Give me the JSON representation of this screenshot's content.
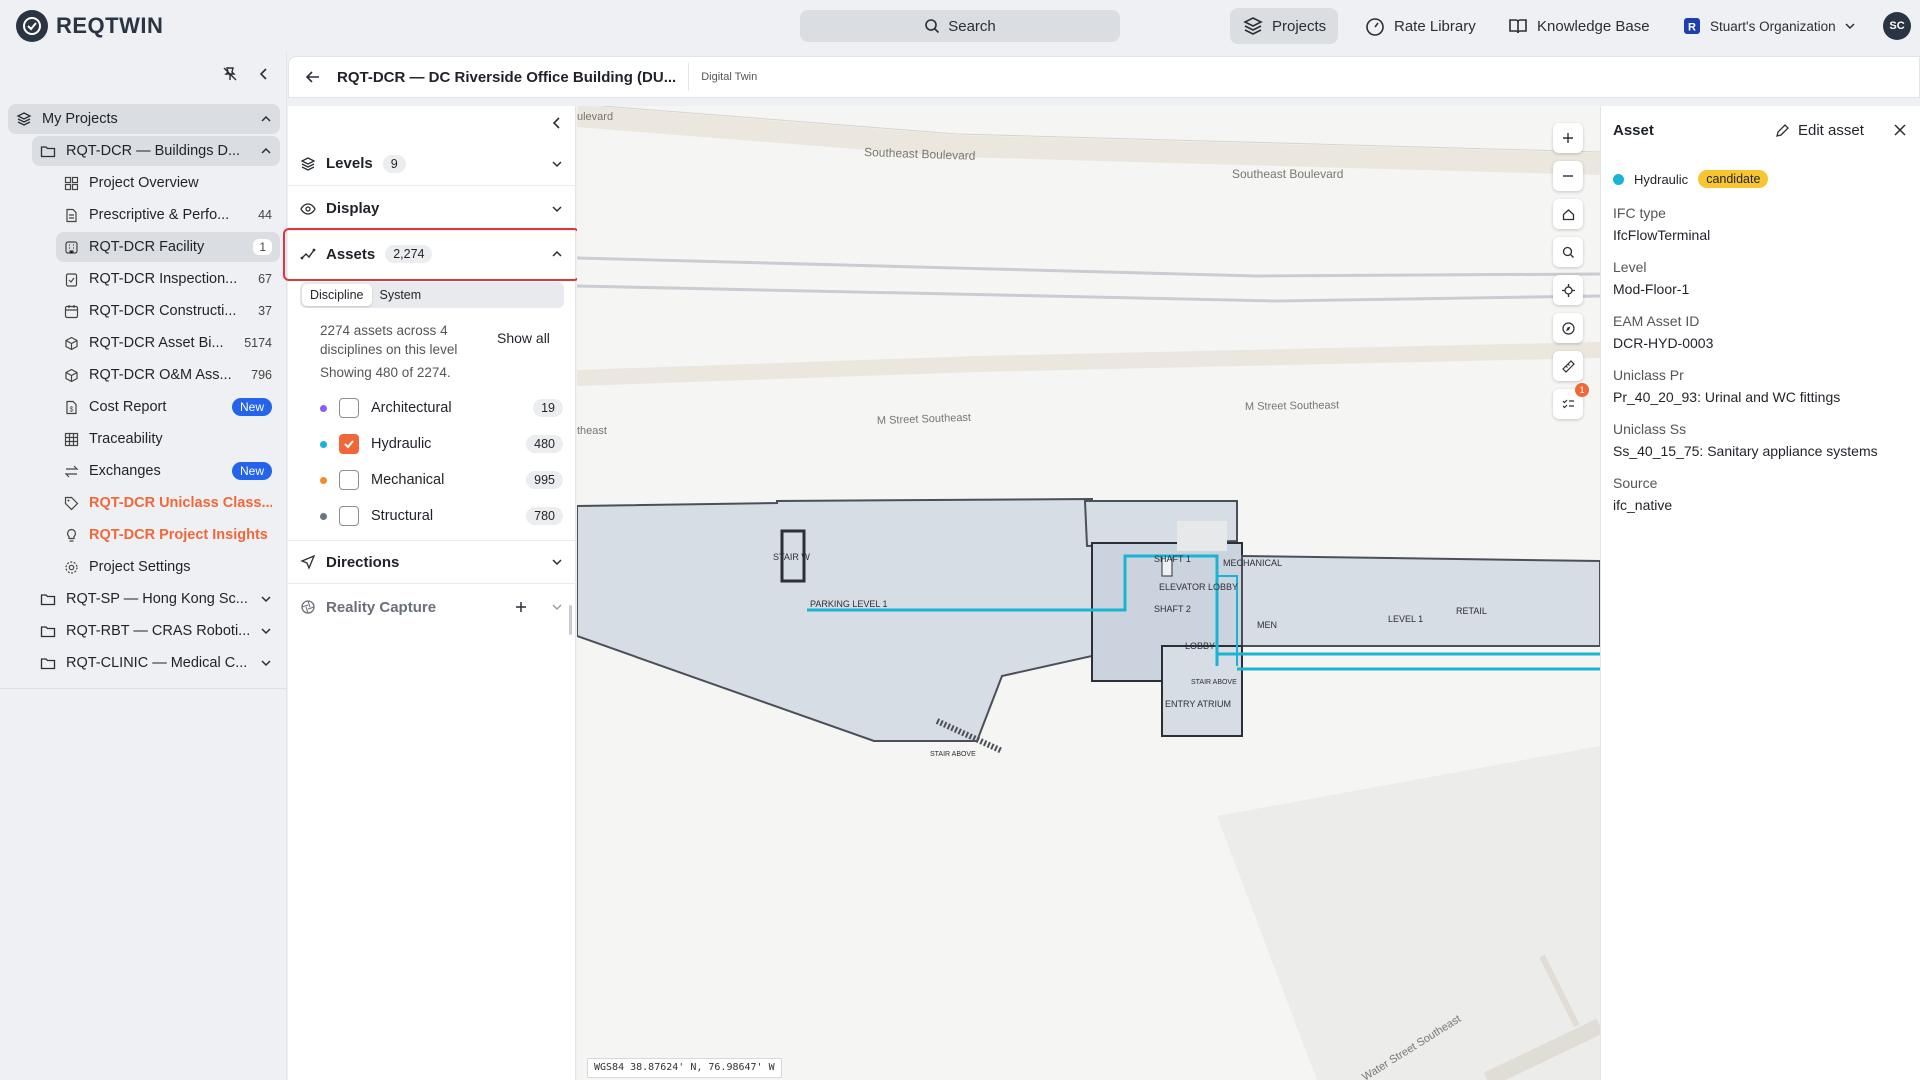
{
  "app": {
    "name": "REQTWIN"
  },
  "topbar": {
    "search_label": "Search",
    "nav": [
      "Projects",
      "Rate Library",
      "Knowledge Base",
      "Stuart's Organization"
    ],
    "avatar": "SC"
  },
  "sidebar": {
    "root": "My Projects",
    "project": "RQT-DCR — Buildings D...",
    "items": [
      {
        "label": "Project Overview",
        "count": ""
      },
      {
        "label": "Prescriptive & Perfo...",
        "count": "44"
      },
      {
        "label": "RQT-DCR Facility",
        "count": "1"
      },
      {
        "label": "RQT-DCR Inspection...",
        "count": "67"
      },
      {
        "label": "RQT-DCR Constructi...",
        "count": "37"
      },
      {
        "label": "RQT-DCR Asset Bi...",
        "count": "5174"
      },
      {
        "label": "RQT-DCR O&M Ass...",
        "count": "796"
      },
      {
        "label": "Cost Report",
        "badge": "New"
      },
      {
        "label": "Traceability",
        "count": ""
      },
      {
        "label": "Exchanges",
        "badge": "New"
      },
      {
        "label": "RQT-DCR Uniclass Class...",
        "count": ""
      },
      {
        "label": "RQT-DCR Project Insights",
        "count": ""
      },
      {
        "label": "Project Settings",
        "count": ""
      }
    ],
    "other_projects": [
      "RQT-SP — Hong Kong Sc...",
      "RQT-RBT — CRAS Roboti...",
      "RQT-CLINIC — Medical C..."
    ]
  },
  "header": {
    "title": "RQT-DCR — DC Riverside Office Building (DU...",
    "subtitle": "Digital Twin"
  },
  "left_panel": {
    "levels_label": "Levels",
    "levels_count": "9",
    "display_label": "Display",
    "assets_label": "Assets",
    "assets_count": "2,274",
    "tabs": [
      "Discipline",
      "System"
    ],
    "summary": "2274 assets across 4 disciplines on this level",
    "showing": "Showing 480 of 2274.",
    "show_all": "Show all",
    "disciplines": [
      {
        "name": "Architectural",
        "count": "19",
        "color": "#8b5cf6",
        "checked": false
      },
      {
        "name": "Hydraulic",
        "count": "480",
        "color": "#19b3d3",
        "checked": true
      },
      {
        "name": "Mechanical",
        "count": "995",
        "color": "#f28c28",
        "checked": false
      },
      {
        "name": "Structural",
        "count": "780",
        "color": "#6b7280",
        "checked": false
      }
    ],
    "directions_label": "Directions",
    "reality_label": "Reality Capture"
  },
  "map": {
    "streets": [
      "Southeast Boulevard",
      "Southeast Boulevard",
      "ulevard",
      "M Street Southeast",
      "M Street Southeast",
      "theast",
      "Water Street Southeast"
    ],
    "rooms": [
      "STAIR W",
      "PARKING LEVEL 1",
      "SHAFT 1",
      "MECHANICAL",
      "ELEVATOR LOBBY",
      "SHAFT 2",
      "MEN",
      "LEVEL 1",
      "RETAIL",
      "LOBBY",
      "STAIR ABOVE",
      "ENTRY ATRIUM",
      "STAIR ABOVE"
    ],
    "coords": "WGS84 38.87624' N, 76.98647' W",
    "notification_count": "1"
  },
  "asset": {
    "panel_title": "Asset",
    "edit_label": "Edit asset",
    "discipline": "Hydraulic",
    "status": "candidate",
    "fields": [
      {
        "key": "IFC type",
        "value": "IfcFlowTerminal"
      },
      {
        "key": "Level",
        "value": "Mod-Floor-1"
      },
      {
        "key": "EAM Asset ID",
        "value": "DCR-HYD-0003"
      },
      {
        "key": "Uniclass Pr",
        "value": "Pr_40_20_93: Urinal and WC fittings"
      },
      {
        "key": "Uniclass Ss",
        "value": "Ss_40_15_75: Sanitary appliance systems"
      },
      {
        "key": "Source",
        "value": "ifc_native"
      }
    ]
  }
}
